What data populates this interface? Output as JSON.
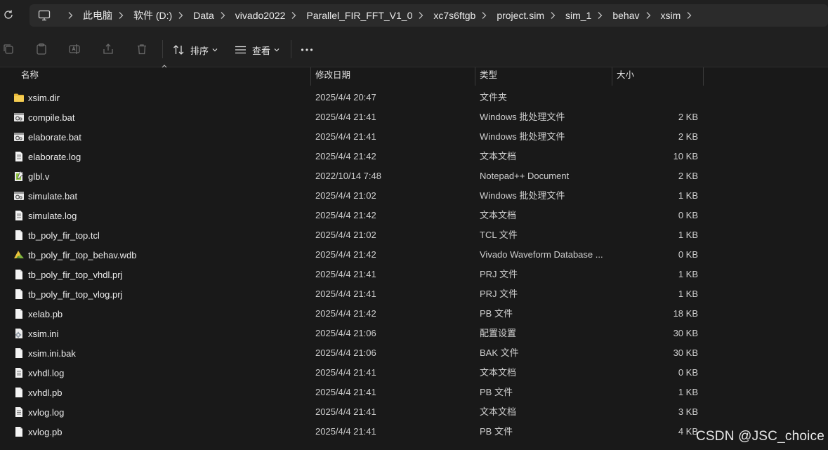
{
  "breadcrumbs": [
    "此电脑",
    "软件 (D:)",
    "Data",
    "vivado2022",
    "Parallel_FIR_FFT_V1_0",
    "xc7s6ftgb",
    "project.sim",
    "sim_1",
    "behav",
    "xsim"
  ],
  "toolbar": {
    "sort_label": "排序",
    "view_label": "查看"
  },
  "columns": {
    "name": "名称",
    "date": "修改日期",
    "type": "类型",
    "size": "大小"
  },
  "files": [
    {
      "name": "xsim.dir",
      "date": "2025/4/4 20:47",
      "type": "文件夹",
      "size": "",
      "icon": "folder-icon"
    },
    {
      "name": "compile.bat",
      "date": "2025/4/4 21:41",
      "type": "Windows 批处理文件",
      "size": "2 KB",
      "icon": "batch-file-icon"
    },
    {
      "name": "elaborate.bat",
      "date": "2025/4/4 21:41",
      "type": "Windows 批处理文件",
      "size": "2 KB",
      "icon": "batch-file-icon"
    },
    {
      "name": "elaborate.log",
      "date": "2025/4/4 21:42",
      "type": "文本文档",
      "size": "10 KB",
      "icon": "text-file-icon"
    },
    {
      "name": "glbl.v",
      "date": "2022/10/14 7:48",
      "type": "Notepad++ Document",
      "size": "2 KB",
      "icon": "notepadpp-file-icon"
    },
    {
      "name": "simulate.bat",
      "date": "2025/4/4 21:02",
      "type": "Windows 批处理文件",
      "size": "1 KB",
      "icon": "batch-file-icon"
    },
    {
      "name": "simulate.log",
      "date": "2025/4/4 21:42",
      "type": "文本文档",
      "size": "0 KB",
      "icon": "text-file-icon"
    },
    {
      "name": "tb_poly_fir_top.tcl",
      "date": "2025/4/4 21:02",
      "type": "TCL 文件",
      "size": "1 KB",
      "icon": "blank-file-icon"
    },
    {
      "name": "tb_poly_fir_top_behav.wdb",
      "date": "2025/4/4 21:42",
      "type": "Vivado Waveform Database ...",
      "size": "0 KB",
      "icon": "vivado-file-icon"
    },
    {
      "name": "tb_poly_fir_top_vhdl.prj",
      "date": "2025/4/4 21:41",
      "type": "PRJ 文件",
      "size": "1 KB",
      "icon": "blank-file-icon"
    },
    {
      "name": "tb_poly_fir_top_vlog.prj",
      "date": "2025/4/4 21:41",
      "type": "PRJ 文件",
      "size": "1 KB",
      "icon": "blank-file-icon"
    },
    {
      "name": "xelab.pb",
      "date": "2025/4/4 21:42",
      "type": "PB 文件",
      "size": "18 KB",
      "icon": "blank-file-icon"
    },
    {
      "name": "xsim.ini",
      "date": "2025/4/4 21:06",
      "type": "配置设置",
      "size": "30 KB",
      "icon": "config-file-icon"
    },
    {
      "name": "xsim.ini.bak",
      "date": "2025/4/4 21:06",
      "type": "BAK 文件",
      "size": "30 KB",
      "icon": "blank-file-icon"
    },
    {
      "name": "xvhdl.log",
      "date": "2025/4/4 21:41",
      "type": "文本文档",
      "size": "0 KB",
      "icon": "text-file-icon"
    },
    {
      "name": "xvhdl.pb",
      "date": "2025/4/4 21:41",
      "type": "PB 文件",
      "size": "1 KB",
      "icon": "blank-file-icon"
    },
    {
      "name": "xvlog.log",
      "date": "2025/4/4 21:41",
      "type": "文本文档",
      "size": "3 KB",
      "icon": "text-file-icon"
    },
    {
      "name": "xvlog.pb",
      "date": "2025/4/4 21:41",
      "type": "PB 文件",
      "size": "4 KB",
      "icon": "blank-file-icon"
    }
  ],
  "watermark": "CSDN @JSC_choice"
}
